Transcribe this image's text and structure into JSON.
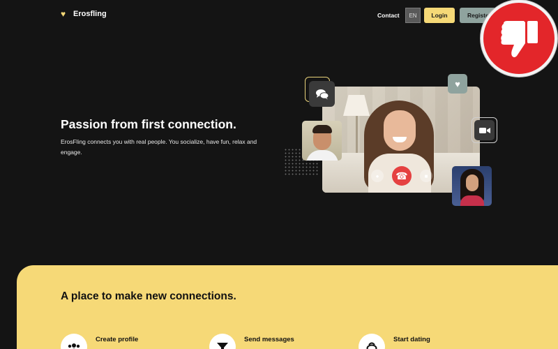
{
  "header": {
    "brand": "Erosfling",
    "contact": "Contact",
    "lang": "EN",
    "login": "Login",
    "register": "Register"
  },
  "badge": {
    "icon": "thumbs-down-icon",
    "color": "#e3262a"
  },
  "hero": {
    "title": "Passion from first connection.",
    "text": "ErosFling connects you with real people. You socialize, have fun, relax and engage."
  },
  "section": {
    "title": "A place to make new connections.",
    "features": [
      {
        "label": "Create profile",
        "icon": "users-icon"
      },
      {
        "label": "Send messages",
        "icon": "funnel-icon"
      },
      {
        "label": "Start dating",
        "icon": "ring-icon"
      }
    ]
  },
  "colors": {
    "background": "#141414",
    "accent": "#f6d977",
    "secondary": "#8fa39e"
  }
}
